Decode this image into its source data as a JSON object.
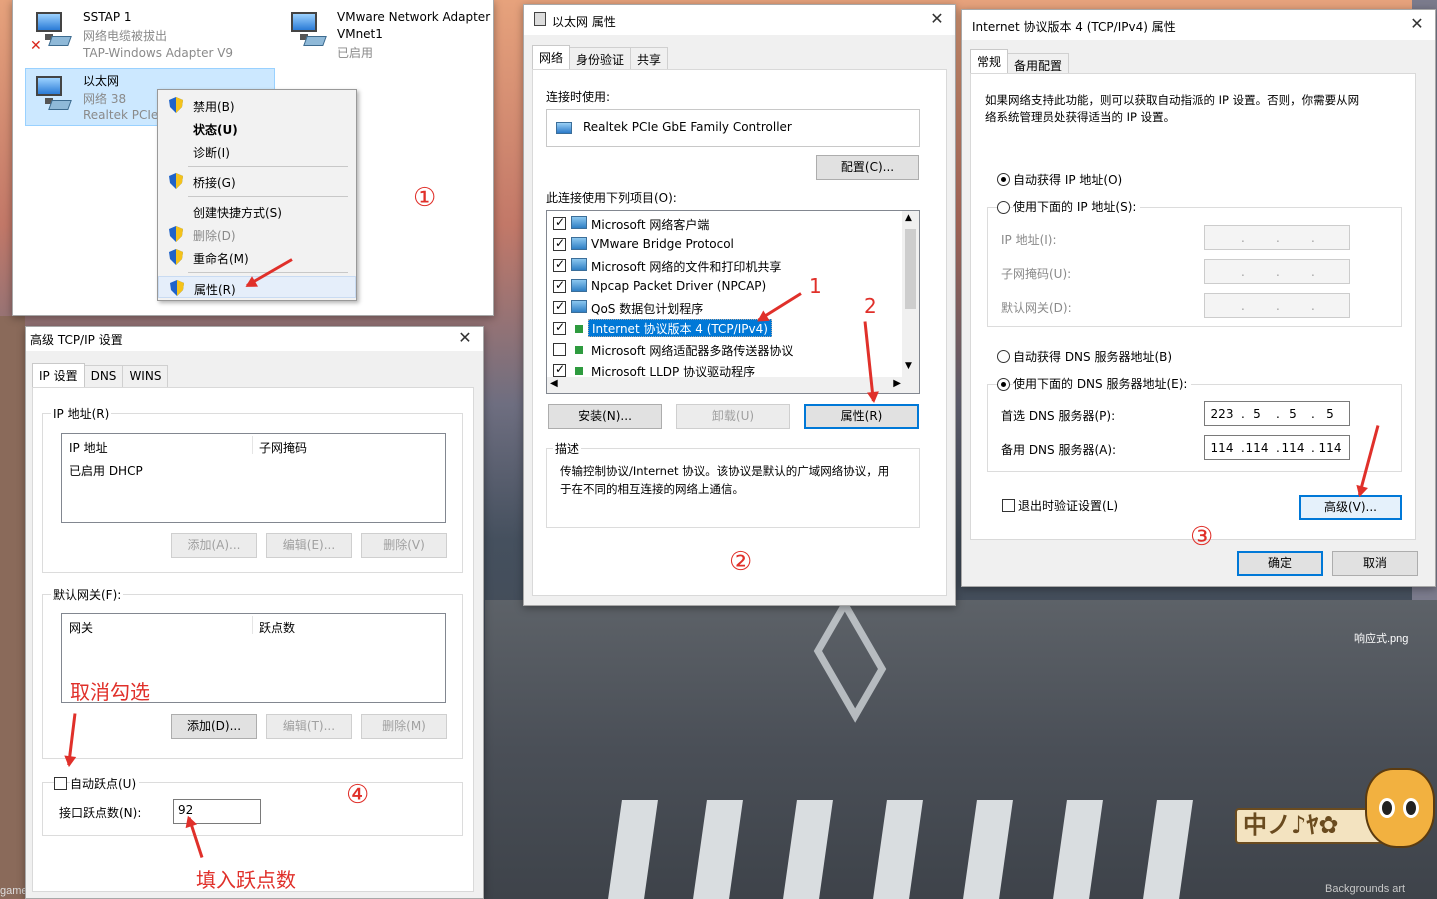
{
  "network_connections": {
    "items": [
      {
        "name": "SSTAP 1",
        "status": "网络电缆被拔出",
        "device": "TAP-Windows Adapter V9"
      },
      {
        "name": "VMware Network Adapter",
        "name2": "VMnet1",
        "status": "已启用"
      },
      {
        "name": "以太网",
        "status": "网络 38",
        "device": "Realtek PCIe"
      }
    ],
    "context_menu": [
      "禁用(B)",
      "状态(U)",
      "诊断(I)",
      "桥接(G)",
      "创建快捷方式(S)",
      "删除(D)",
      "重命名(M)",
      "属性(R)"
    ]
  },
  "ethernet_props": {
    "title": "以太网 属性",
    "tabs": [
      "网络",
      "身份验证",
      "共享"
    ],
    "connect_using_label": "连接时使用:",
    "adapter": "Realtek PCIe GbE Family Controller",
    "configure_btn": "配置(C)...",
    "items_label": "此连接使用下列项目(O):",
    "items": [
      {
        "label": "Microsoft 网络客户端",
        "checked": true
      },
      {
        "label": "VMware Bridge Protocol",
        "checked": true
      },
      {
        "label": "Microsoft 网络的文件和打印机共享",
        "checked": true
      },
      {
        "label": "Npcap Packet Driver (NPCAP)",
        "checked": true
      },
      {
        "label": "QoS 数据包计划程序",
        "checked": true
      },
      {
        "label": "Internet 协议版本 4 (TCP/IPv4)",
        "checked": true
      },
      {
        "label": "Microsoft 网络适配器多路传送器协议",
        "checked": false
      },
      {
        "label": "Microsoft LLDP 协议驱动程序",
        "checked": true
      }
    ],
    "install_btn": "安装(N)...",
    "uninstall_btn": "卸载(U)",
    "properties_btn": "属性(R)",
    "desc_label": "描述",
    "desc_text_1": "传输控制协议/Internet 协议。该协议是默认的广域网络协议，用",
    "desc_text_2": "于在不同的相互连接的网络上通信。"
  },
  "ipv4_props": {
    "title": "Internet 协议版本 4 (TCP/IPv4) 属性",
    "tabs": [
      "常规",
      "备用配置"
    ],
    "intro_1": "如果网络支持此功能，则可以获取自动指派的 IP 设置。否则，你需要从网",
    "intro_2": "络系统管理员处获得适当的 IP 设置。",
    "auto_ip": "自动获得 IP 地址(O)",
    "manual_ip": "使用下面的 IP 地址(S):",
    "ip_label": "IP 地址(I):",
    "mask_label": "子网掩码(U):",
    "gw_label": "默认网关(D):",
    "auto_dns": "自动获得 DNS 服务器地址(B)",
    "manual_dns": "使用下面的 DNS 服务器地址(E):",
    "pref_dns_label": "首选 DNS 服务器(P):",
    "alt_dns_label": "备用 DNS 服务器(A):",
    "pref_dns": [
      "223",
      "5",
      "5",
      "5"
    ],
    "alt_dns": [
      "114",
      "114",
      "114",
      "114"
    ],
    "validate": "退出时验证设置(L)",
    "advanced_btn": "高级(V)...",
    "ok_btn": "确定",
    "cancel_btn": "取消"
  },
  "advanced_tcpip": {
    "title": "高级 TCP/IP 设置",
    "tabs": [
      "IP 设置",
      "DNS",
      "WINS"
    ],
    "ip_group": "IP 地址(R)",
    "ip_col1": "IP 地址",
    "ip_col2": "子网掩码",
    "ip_row": "已启用 DHCP",
    "add_btn": "添加(A)...",
    "edit_btn": "编辑(E)...",
    "remove_btn": "删除(V)",
    "gw_group": "默认网关(F):",
    "gw_col1": "网关",
    "gw_col2": "跃点数",
    "gw_add_btn": "添加(D)...",
    "gw_edit_btn": "编辑(T)...",
    "gw_remove_btn": "删除(M)",
    "auto_metric": "自动跃点(U)",
    "metric_label": "接口跃点数(N):",
    "metric_value": "92"
  },
  "annotations": {
    "c1": "①",
    "c2": "②",
    "c3": "③",
    "c4": "④",
    "n1": "1",
    "n2": "2",
    "uncheck": "取消勾选",
    "fill_metric": "填入跃点数"
  },
  "wallpaper": {
    "file_label": "响应式.png",
    "credit": "Backgrounds art",
    "left_text_1": "game",
    "stamp_text": "中ノ♪ﾔ✿"
  }
}
